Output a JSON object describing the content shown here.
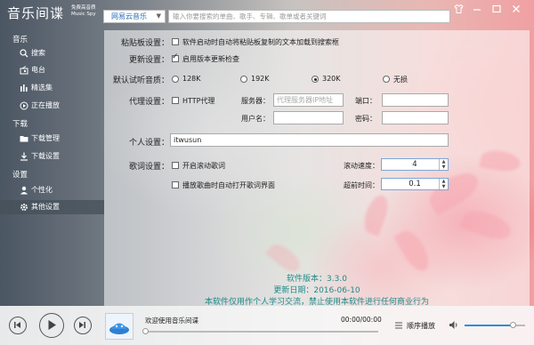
{
  "app": {
    "title": "音乐间谍",
    "tagline_cn": "免费高音质",
    "tagline_en": "Music Spy"
  },
  "toolbar": {
    "source_selected": "网易云音乐",
    "search_placeholder": "输入你要搜索的单曲、歌手、专辑、歌单或者关键词"
  },
  "window_controls": [
    "skin-icon",
    "minimize-icon",
    "maximize-icon",
    "close-icon"
  ],
  "sidebar": {
    "sections": [
      {
        "title": "音乐",
        "items": [
          {
            "label": "搜索",
            "icon": "search-icon"
          },
          {
            "label": "电台",
            "icon": "radio-icon"
          },
          {
            "label": "精选集",
            "icon": "bars-icon"
          },
          {
            "label": "正在播放",
            "icon": "play-icon"
          }
        ]
      },
      {
        "title": "下载",
        "items": [
          {
            "label": "下载管理",
            "icon": "folder-icon"
          },
          {
            "label": "下载设置",
            "icon": "download-icon"
          }
        ]
      },
      {
        "title": "设置",
        "items": [
          {
            "label": "个性化",
            "icon": "user-icon"
          },
          {
            "label": "其他设置",
            "icon": "gear-icon"
          }
        ]
      }
    ],
    "active_item": "其他设置"
  },
  "settings": {
    "clipboard": {
      "label": "粘贴板设置：",
      "option": "软件启动时自动将粘贴板复制的文本加载到搜索框",
      "checked": false
    },
    "update": {
      "label": "更新设置：",
      "option": "启用版本更新检查",
      "checked": true
    },
    "quality": {
      "label": "默认试听音质：",
      "options": [
        "128K",
        "192K",
        "320K",
        "无损"
      ],
      "selected": "320K"
    },
    "proxy": {
      "label": "代理设置：",
      "option": "HTTP代理",
      "checked": false,
      "server_label": "服务器：",
      "server_placeholder": "代理服务器IP地址",
      "port_label": "端口：",
      "user_label": "用户名：",
      "password_label": "密码："
    },
    "personal": {
      "label": "个人设置：",
      "value": "itwusun"
    },
    "lyrics": {
      "label": "歌词设置：",
      "scroll_option": "开启滚动歌词",
      "scroll_checked": false,
      "auto_open_option": "播放歌曲时自动打开歌词界面",
      "auto_open_checked": false,
      "speed_label": "滚动速度：",
      "speed_value": "4",
      "advance_label": "超前时间：",
      "advance_value": "0.1"
    }
  },
  "version": {
    "version_line": "软件版本：3.3.0",
    "date_line": "更新日期：2016-06-10",
    "notice_line": "本软件仅用作个人学习交流，禁止使用本软件进行任何商业行为"
  },
  "player": {
    "now_playing": "欢迎使用音乐间谍",
    "time": "00:00/00:00",
    "mode": "顺序播放",
    "progress": 0,
    "volume": 0.8
  },
  "colors": {
    "version_text": "#1f8a8a",
    "accent_link": "#2a6fb8"
  }
}
